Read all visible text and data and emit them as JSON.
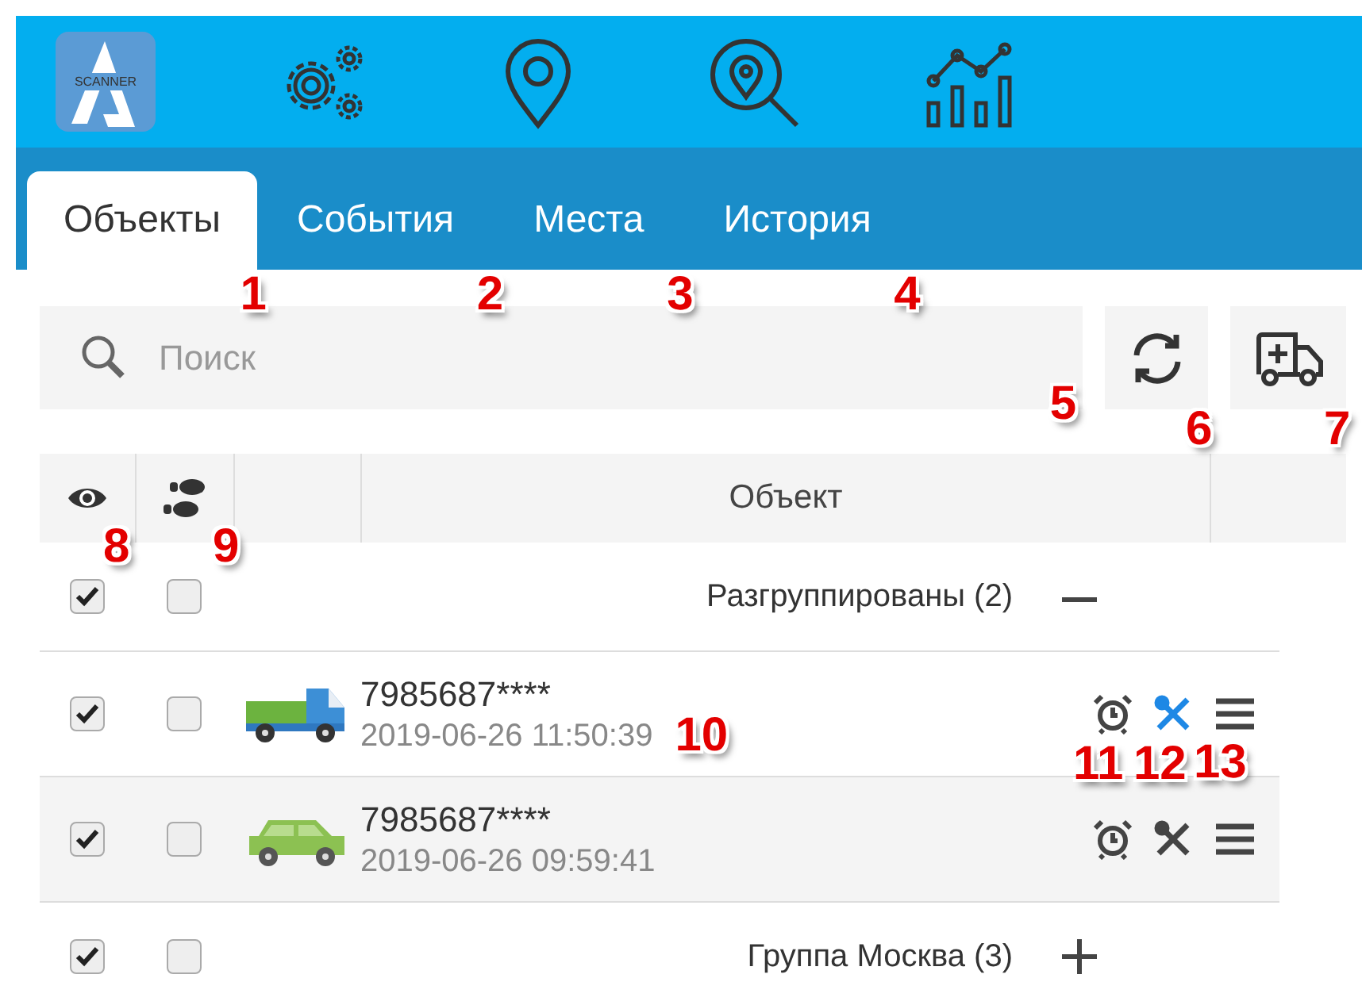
{
  "logo": {
    "text": "SCANNER"
  },
  "nav_icons": [
    {
      "kind": "gears"
    },
    {
      "kind": "pin"
    },
    {
      "kind": "pin-search"
    },
    {
      "kind": "chart"
    }
  ],
  "tabs": [
    {
      "label": "Объекты",
      "selected": true,
      "callout": "1"
    },
    {
      "label": "События",
      "selected": false,
      "callout": "2"
    },
    {
      "label": "Места",
      "selected": false,
      "callout": "3"
    },
    {
      "label": "История",
      "selected": false,
      "callout": "4"
    }
  ],
  "search": {
    "placeholder": "Поиск",
    "callout": "5"
  },
  "actions": [
    {
      "kind": "refresh",
      "callout": "6"
    },
    {
      "kind": "add-vehicle",
      "callout": "7"
    }
  ],
  "table": {
    "columns": [
      {
        "kind": "visibility",
        "callout": "8"
      },
      {
        "kind": "track",
        "callout": "9"
      },
      {
        "kind": "blank"
      },
      {
        "kind": "label",
        "label": "Объект"
      },
      {
        "kind": "blank"
      }
    ],
    "rows": [
      {
        "kind": "group",
        "label": "Разгруппированы (2)",
        "visible": true,
        "track": false,
        "expanded": true
      },
      {
        "kind": "object",
        "vehicle": {
          "kind": "truck"
        },
        "name": "7985687****",
        "time": "2019-06-26 11:50:39",
        "time_callout": "10",
        "visible": true,
        "track": false,
        "actions": [
          {
            "kind": "alarm",
            "callout": "11"
          },
          {
            "kind": "tools",
            "active": true,
            "callout": "12"
          },
          {
            "kind": "menu",
            "callout": "13"
          }
        ]
      },
      {
        "kind": "object",
        "vehicle": {
          "kind": "car"
        },
        "name": "7985687****",
        "time": "2019-06-26 09:59:41",
        "visible": true,
        "track": false,
        "actions": [
          {
            "kind": "alarm"
          },
          {
            "kind": "tools",
            "active": false
          },
          {
            "kind": "menu"
          }
        ]
      },
      {
        "kind": "group",
        "label": "Группа Москва (3)",
        "visible": true,
        "track": false,
        "expanded": false
      }
    ]
  }
}
